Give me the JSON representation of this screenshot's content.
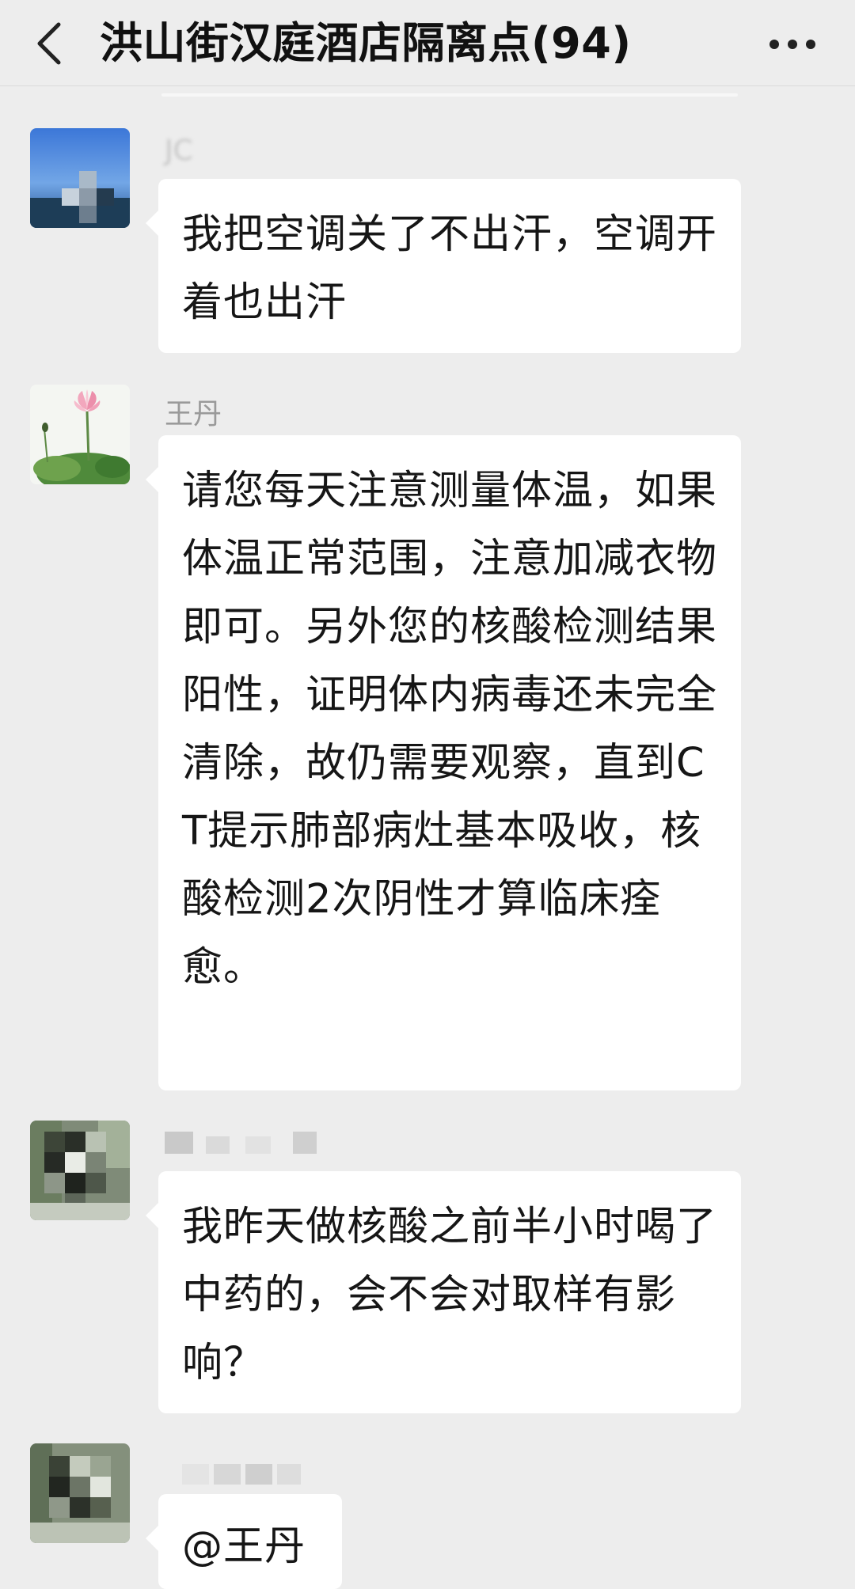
{
  "header": {
    "title": "洪山街汉庭酒店隔离点(94)",
    "back_icon": "chevron-left-icon",
    "more_icon": "more-dots-icon"
  },
  "messages": [
    {
      "sender": "JC",
      "text": "我把空调关了不出汗，空调开着也出汗",
      "avatar": "avatar-sky-blurred"
    },
    {
      "sender": "王丹",
      "text": "请您每天注意测量体温，如果体温正常范围，注意加减衣物即可。另外您的核酸检测结果阳性，证明体内病毒还未完全清除，故仍需要观察，直到CT提示肺部病灶基本吸收，核酸检测2次阴性才算临床痊愈。",
      "avatar": "avatar-lotus"
    },
    {
      "sender": "",
      "text": "我昨天做核酸之前半小时喝了中药的，会不会对取样有影响？",
      "avatar": "avatar-garden-blurred"
    },
    {
      "sender": "",
      "text": "@王丹",
      "avatar": "avatar-garden-blurred"
    }
  ],
  "colors": {
    "background": "#ededed",
    "bubble": "#ffffff",
    "sender": "#9a9a9a",
    "text": "#161616"
  }
}
